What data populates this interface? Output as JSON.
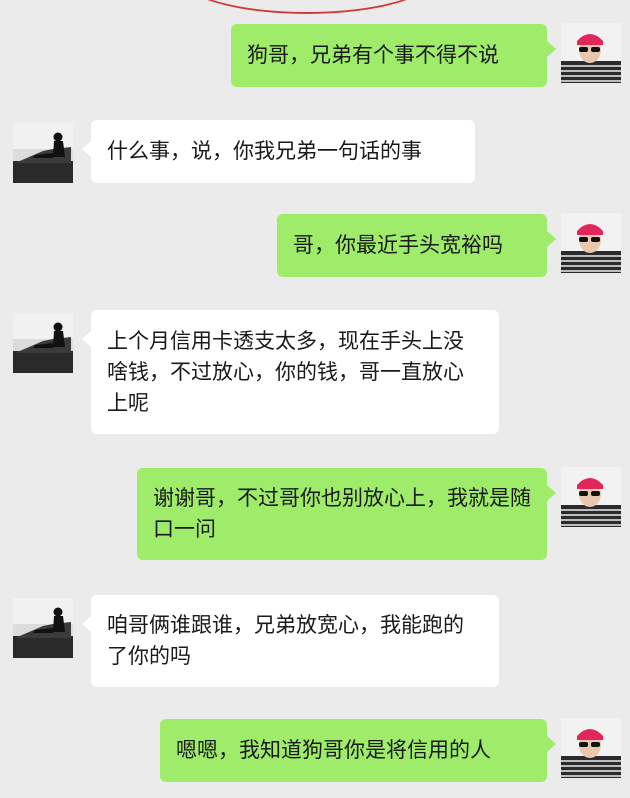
{
  "messages": [
    {
      "side": "out",
      "text": "狗哥，兄弟有个事不得不说",
      "avatar": "self-avatar"
    },
    {
      "side": "in",
      "text": "什么事，说，你我兄弟一句话的事",
      "avatar": "friend-avatar"
    },
    {
      "side": "out",
      "text": "哥，你最近手头宽裕吗",
      "avatar": "self-avatar"
    },
    {
      "side": "in",
      "text": "上个月信用卡透支太多，现在手头上没啥钱，不过放心，你的钱，哥一直放心上呢",
      "avatar": "friend-avatar"
    },
    {
      "side": "out",
      "text": "谢谢哥，不过哥你也别放心上，我就是随口一问",
      "avatar": "self-avatar"
    },
    {
      "side": "in",
      "text": "咱哥俩谁跟谁，兄弟放宽心，我能跑的了你的吗",
      "avatar": "friend-avatar"
    },
    {
      "side": "out",
      "text": "嗯嗯，我知道狗哥你是将信用的人",
      "avatar": "self-avatar"
    }
  ],
  "colors": {
    "background": "#ebebeb",
    "outgoing_bubble": "#9feb6a",
    "incoming_bubble": "#ffffff"
  }
}
